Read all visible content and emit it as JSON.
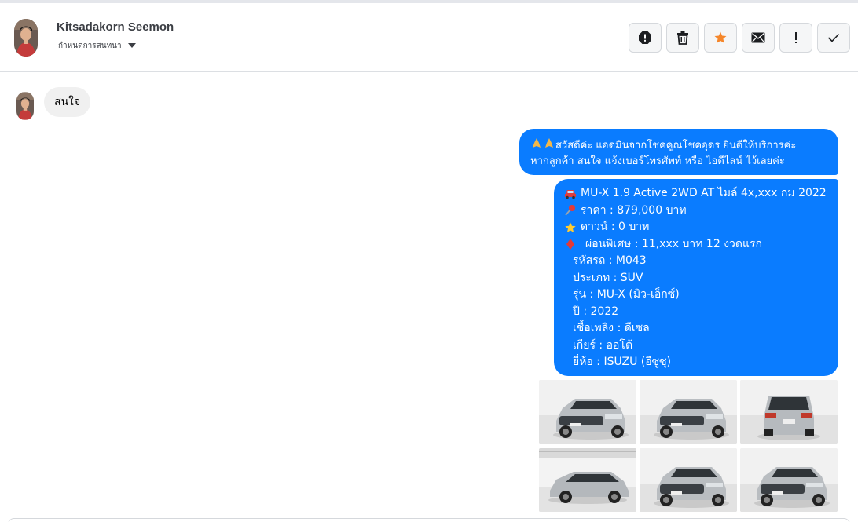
{
  "header": {
    "contact_name": "Kitsadakorn Seemon",
    "assign_label": "กำหนดการสนทนา",
    "actions": [
      {
        "name": "report-icon"
      },
      {
        "name": "trash-icon"
      },
      {
        "name": "star-icon"
      },
      {
        "name": "mail-icon"
      },
      {
        "name": "exclamation-icon"
      },
      {
        "name": "check-icon"
      }
    ]
  },
  "colors": {
    "outgoing_bubble": "#0a7cff",
    "incoming_bubble": "#f0f0f0",
    "star": "#f5862a"
  },
  "messages": {
    "incoming_text": "สนใจ",
    "greeting": {
      "line1": "สวัสดีค่ะ แอดมินจากโชคคูณโชคอุดร ยินดีให้บริการค่ะ",
      "line2": "หากลูกค้า สนใจ แจ้งเบอร์โทรศัพท์ หรือ ไอดีไลน์  ไว้เลยค่ะ"
    },
    "listing": {
      "title": "MU-X 1.9 Active 2WD AT ไมล์ 4x,xxx กม 2022",
      "price": "ราคา : 879,000 บาท",
      "down": "ดาวน์ : 0 บาท",
      "installment": "ผ่อนพิเศษ : 11,xxx บาท 12 งวดแรก",
      "code": "รหัสรถ : M043",
      "type": "ประเภท : SUV",
      "model": "รุ่น : MU-X (มิว-เอ็กซ์)",
      "year": "ปี : 2022",
      "fuel": "เชื้อเพลิง : ดีเซล",
      "gear": "เกียร์ : ออโต้",
      "brand": "ยี่ห้อ : ISUZU (อีซูซุ)"
    },
    "photos": [
      {
        "view": "front"
      },
      {
        "view": "front"
      },
      {
        "view": "rear"
      },
      {
        "view": "side"
      },
      {
        "view": "front"
      },
      {
        "view": "front"
      }
    ]
  }
}
